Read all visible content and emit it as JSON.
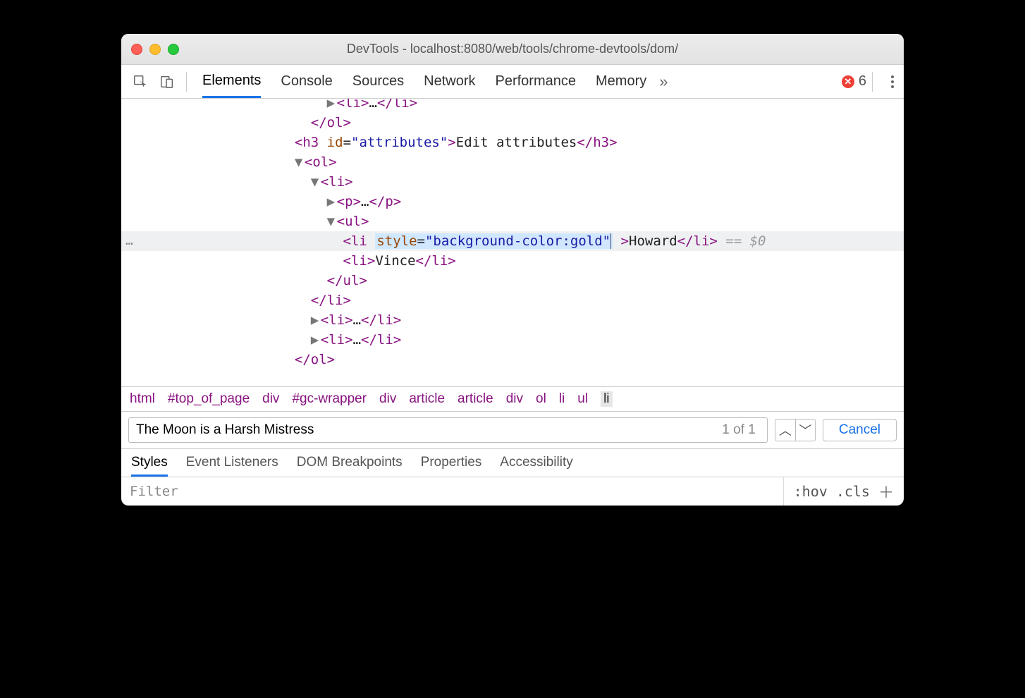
{
  "window": {
    "title": "DevTools - localhost:8080/web/tools/chrome-devtools/dom/"
  },
  "toolbar": {
    "tabs": [
      "Elements",
      "Console",
      "Sources",
      "Network",
      "Performance",
      "Memory"
    ],
    "active_tab": 0,
    "error_count": "6"
  },
  "dom_lines": [
    {
      "indent": 11,
      "arrow": "▶",
      "raw": "<li>…</li>",
      "cls": "partial-top"
    },
    {
      "indent": 10,
      "raw": "</ol>"
    },
    {
      "indent": 9,
      "raw_html": "<span class='tag'>&lt;h3 </span><span class='attr'>id</span>=<span class='val'>\"attributes\"</span><span class='tag'>&gt;</span><span class='text'>Edit attributes</span><span class='tag'>&lt;/h3&gt;</span>"
    },
    {
      "indent": 9,
      "arrow": "▼",
      "raw": "<ol>"
    },
    {
      "indent": 10,
      "arrow": "▼",
      "raw": "<li>"
    },
    {
      "indent": 11,
      "arrow": "▶",
      "raw": "<p>…</p>"
    },
    {
      "indent": 11,
      "arrow": "▼",
      "raw": "<ul>"
    },
    {
      "indent": 12,
      "hl": true,
      "raw_html": "<span class='tag'>&lt;li</span> <span class='sel'><span class='attr'>style</span>=<span class='val'>\"background-color:gold\"</span><span class='caret'></span></span> <span class='tag'>&gt;</span><span class='text'>Howard</span><span class='tag'>&lt;/li&gt;</span> <span class='muted'>== $0</span>"
    },
    {
      "indent": 12,
      "raw_html": "<span class='tag'>&lt;li&gt;</span><span class='text'>Vince</span><span class='tag'>&lt;/li&gt;</span>"
    },
    {
      "indent": 11,
      "raw": "</ul>"
    },
    {
      "indent": 10,
      "raw": "</li>"
    },
    {
      "indent": 10,
      "arrow": "▶",
      "raw": "<li>…</li>"
    },
    {
      "indent": 10,
      "arrow": "▶",
      "raw": "<li>…</li>"
    },
    {
      "indent": 9,
      "raw": "</ol>"
    }
  ],
  "selected_attr_edit": "style=\"background-color:gold\"",
  "selected_text": "Howard",
  "inspector_ref": "== $0",
  "breadcrumb": [
    "html",
    "#top_of_page",
    "div",
    "#gc-wrapper",
    "div",
    "article",
    "article",
    "div",
    "ol",
    "li",
    "ul",
    "li"
  ],
  "breadcrumb_current_index": 11,
  "search": {
    "value": "The Moon is a Harsh Mistress",
    "count": "1 of 1",
    "cancel": "Cancel"
  },
  "subtabs": [
    "Styles",
    "Event Listeners",
    "DOM Breakpoints",
    "Properties",
    "Accessibility"
  ],
  "subtab_active": 0,
  "styles": {
    "filter_placeholder": "Filter",
    "hov": ":hov",
    "cls": ".cls"
  }
}
